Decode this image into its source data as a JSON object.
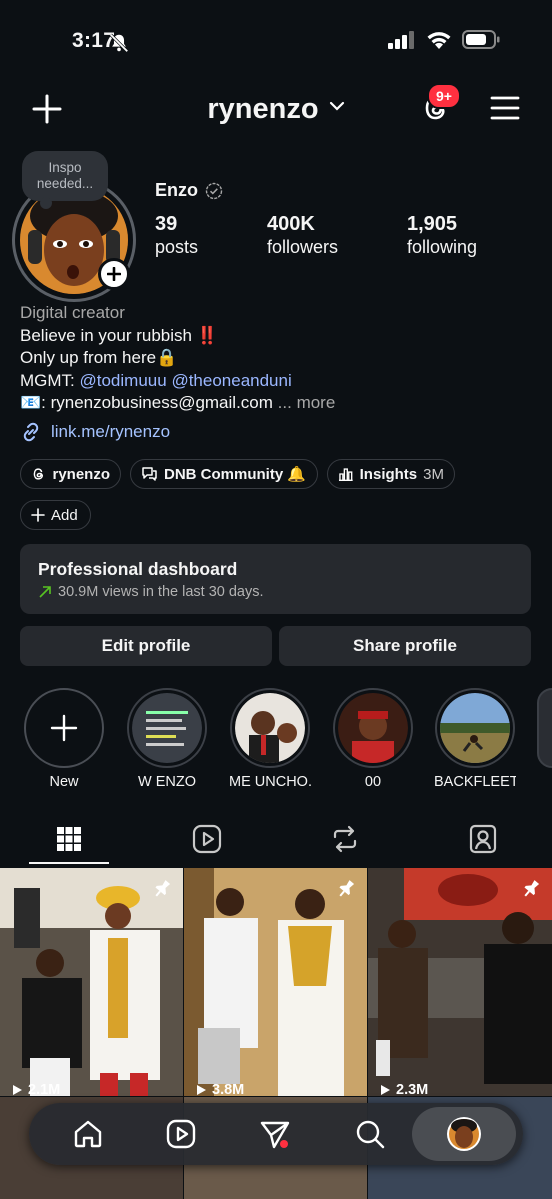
{
  "status_bar": {
    "time": "3:17"
  },
  "header": {
    "username": "rynenzo",
    "notification_badge": "9+"
  },
  "profile": {
    "note": "Inspo needed...",
    "name": "Enzo",
    "stats": [
      {
        "value": "39",
        "label": "posts"
      },
      {
        "value": "400K",
        "label": "followers"
      },
      {
        "value": "1,905",
        "label": "following"
      }
    ]
  },
  "bio": {
    "category": "Digital creator",
    "line1": "Believe in your rubbish ‼️",
    "line2": "Only up from here🔒",
    "mgmt_prefix": "MGMT: ",
    "mention1": "@todimuuu",
    "mention2": "@theoneanduni",
    "email_line": "📧: rynenzobusiness@gmail.com",
    "ellipsis": " ...",
    "more": "more",
    "link": "link.me/rynenzo"
  },
  "chips": {
    "threads": "rynenzo",
    "community": "DNB Community 🔔",
    "insights": "Insights",
    "insights_count": "3M",
    "add": "Add"
  },
  "dashboard": {
    "title": "Professional dashboard",
    "subtitle": "30.9M views in the last 30 days."
  },
  "buttons": {
    "edit": "Edit profile",
    "share": "Share profile"
  },
  "highlights": [
    {
      "label": "New"
    },
    {
      "label": "W ENZO"
    },
    {
      "label": "ME UNCHO..."
    },
    {
      "label": "00"
    },
    {
      "label": "BACKFLEET"
    }
  ],
  "grid": [
    {
      "views": "2.1M",
      "pinned": true
    },
    {
      "views": "3.8M",
      "pinned": true
    },
    {
      "views": "2.3M",
      "pinned": true
    }
  ],
  "colors": {
    "background": "#0c1014",
    "accent_link": "#a5c3ff",
    "badge": "#ff3040"
  }
}
